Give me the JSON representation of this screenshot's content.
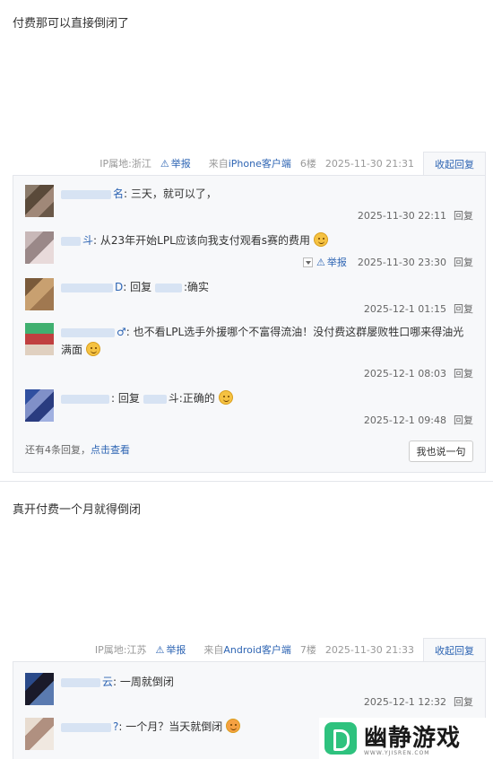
{
  "posts": [
    {
      "text": "付费那可以直接倒闭了",
      "ip": "IP属地:浙江",
      "report": "举报",
      "client_prefix": "来自",
      "client_name": "iPhone客户端",
      "floor": "6楼",
      "time": "2025-11-30 21:31",
      "collapse": "收起回复",
      "replies": [
        {
          "user_tail": "名",
          "text": ": 三天，就可以了，",
          "time": "2025-11-30 22:11",
          "reply": "回复",
          "emoji": ""
        },
        {
          "user_tail": "斗",
          "text": ": 从23年开始LPL应该向我支付观看s赛的费用",
          "time": "2025-11-30 23:30",
          "reply": "回复",
          "report": "举报",
          "emoji": "tongue"
        },
        {
          "user_tail": "D",
          "text": ": 回复",
          "text2": ":确实",
          "time": "2025-12-1 01:15",
          "reply": "回复",
          "emoji": ""
        },
        {
          "user_tail": "♂",
          "text": ": 也不看LPL选手外援哪个不富得流油！没付费这群屡败牲口哪来得油光满面",
          "time": "2025-12-1 08:03",
          "reply": "回复",
          "emoji": "smile"
        },
        {
          "user_tail": "",
          "text": ": 回复",
          "text2": "斗:正确的",
          "time": "2025-12-1 09:48",
          "reply": "回复",
          "emoji": "smile"
        }
      ],
      "more_prefix": "还有4条回复，",
      "more_link": "点击查看",
      "say_button": "我也说一句"
    },
    {
      "text": "真开付费一个月就得倒闭",
      "ip": "IP属地:江苏",
      "report": "举报",
      "client_prefix": "来自",
      "client_name": "Android客户端",
      "floor": "7楼",
      "time": "2025-11-30 21:33",
      "collapse": "收起回复",
      "replies": [
        {
          "user_tail": "云",
          "text": ": 一周就倒闭",
          "time": "2025-12-1 12:32",
          "reply": "回复",
          "emoji": ""
        },
        {
          "user_tail": "?",
          "text": ": 一个月？当天就倒闭",
          "emoji": "angry"
        }
      ]
    }
  ],
  "watermark": {
    "title": "幽静游戏",
    "subtitle": "WWW.YJISREN.COM"
  },
  "colors": {
    "link": "#2d64b3",
    "thread_bg": "#f7f8fa",
    "border": "#e4e6eb"
  }
}
